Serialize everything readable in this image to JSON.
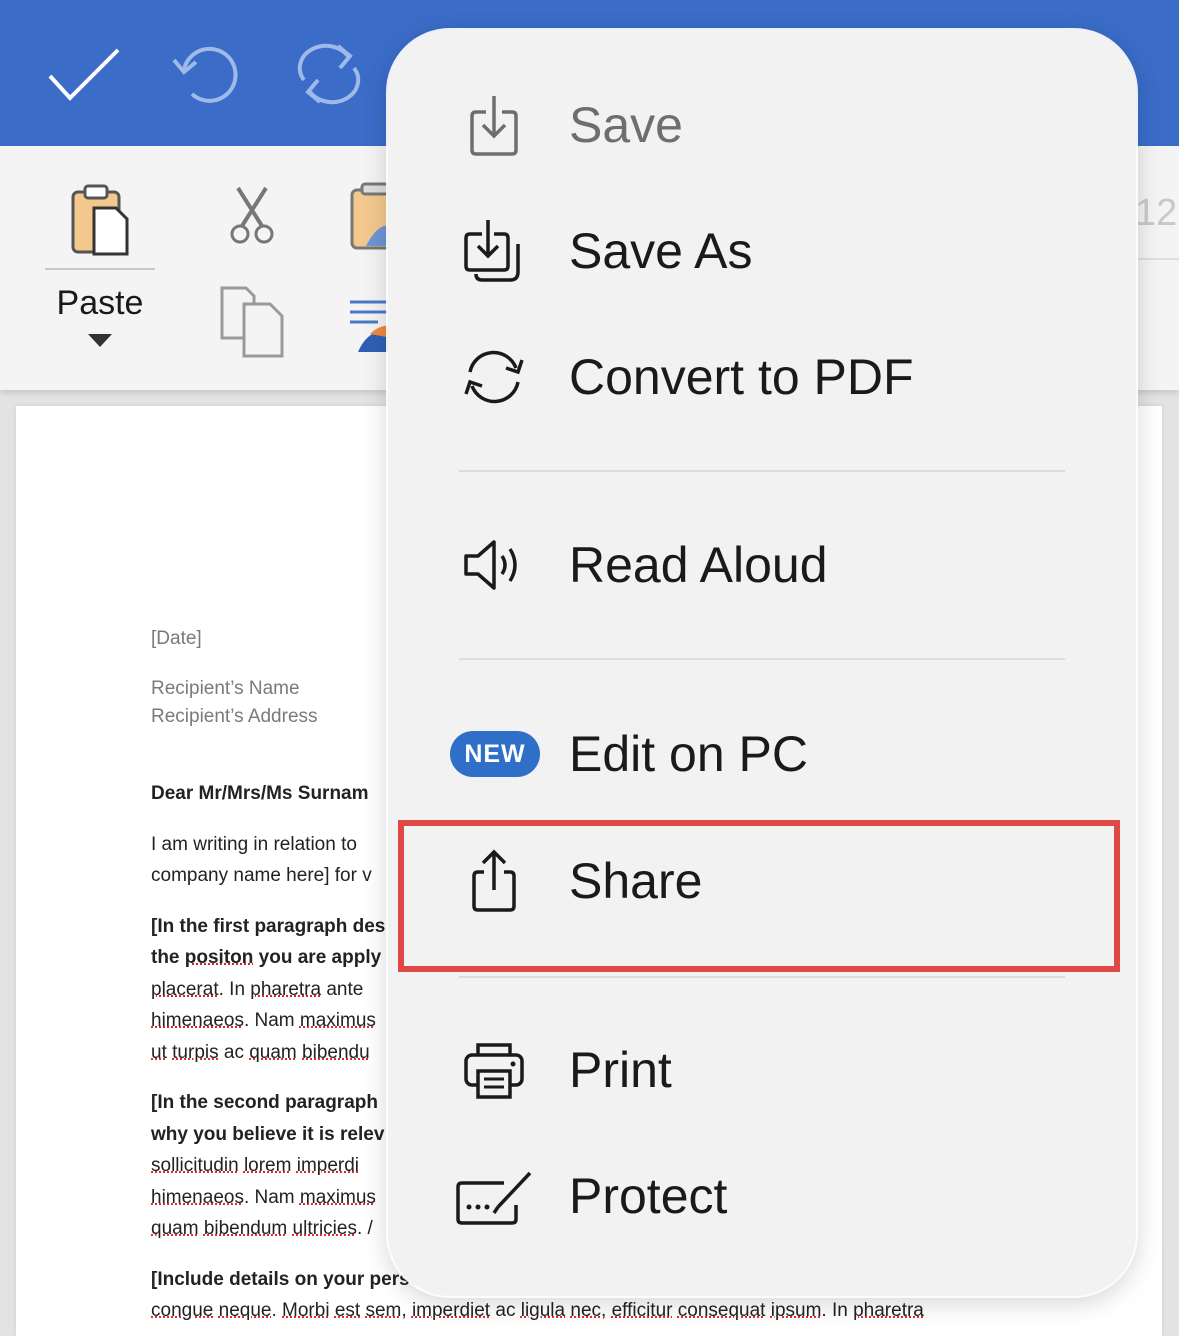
{
  "toolbar": {
    "paste_label": "Paste",
    "font_size_partial": "12"
  },
  "menu": {
    "items": [
      {
        "label": "Save"
      },
      {
        "label": "Save As"
      },
      {
        "label": "Convert to PDF"
      },
      {
        "label": "Read Aloud"
      },
      {
        "label": "Edit on PC",
        "badge": "NEW"
      },
      {
        "label": "Share"
      },
      {
        "label": "Print"
      },
      {
        "label": "Protect"
      }
    ]
  },
  "document": {
    "date": "[Date]",
    "recipient_name": "Recipient’s Name",
    "recipient_address": "Recipient’s Address",
    "salutation": "Dear Mr/Mrs/Ms Surnam",
    "line1": "I am writing in relation to",
    "line2": "company name here] for v",
    "para1_line1": "[In the first paragraph des",
    "para1_line2_a": "the ",
    "para1_line2_b": "positon",
    "para1_line2_c": " you are apply",
    "para1_line3_a": "placerat",
    "para1_line3_b": ". In ",
    "para1_line3_c": "pharetra",
    "para1_line3_d": " ante",
    "para1_line4_a": "himenaeos",
    "para1_line4_b": ". Nam ",
    "para1_line4_c": "maximus",
    "para1_line5_a": "ut",
    "para1_line5_b": " ",
    "para1_line5_c": "turpis",
    "para1_line5_d": " ac ",
    "para1_line5_e": "quam",
    "para1_line5_f": " ",
    "para1_line5_g": "bibendu",
    "para2_line1": "[In the second paragraph",
    "para2_line2": "why you believe it is relev",
    "para2_line3_a": "sollicitudin",
    "para2_line3_b": " ",
    "para2_line3_c": "lorem",
    "para2_line3_d": " ",
    "para2_line3_e": "imperdi",
    "para2_line4_a": "himenaeos",
    "para2_line4_b": ". Nam ",
    "para2_line4_c": "maximus",
    "para2_line5_a": "quam",
    "para2_line5_b": " ",
    "para2_line5_c": "bibendum",
    "para2_line5_d": " ",
    "para2_line5_e": "ultricies",
    "para2_line5_f": ". /",
    "para3_line1": "[Include details on your perso",
    "para3_line2_a": "congue",
    "para3_line2_b": " ",
    "para3_line2_c": "neque",
    "para3_line2_d": ". ",
    "para3_line2_e": "Morbi",
    "para3_line2_f": " ",
    "para3_line2_g": "est",
    "para3_line2_h": " ",
    "para3_line2_i": "sem",
    "para3_line2_j": ", ",
    "para3_line2_k": "imperdiet",
    "para3_line2_l": " ac ",
    "para3_line2_m": "ligula",
    "para3_line2_n": " ",
    "para3_line2_o": "nec",
    "para3_line2_p": ", ",
    "para3_line2_q": "efficitur",
    "para3_line2_r": " ",
    "para3_line2_s": "consequat",
    "para3_line2_t": " ",
    "para3_line2_u": "ipsum",
    "para3_line2_v": ". In ",
    "para3_line2_w": "pharetra"
  },
  "colors": {
    "topbar": "#3a6cc8",
    "badge": "#2f6fc7",
    "highlight": "#e04848"
  }
}
